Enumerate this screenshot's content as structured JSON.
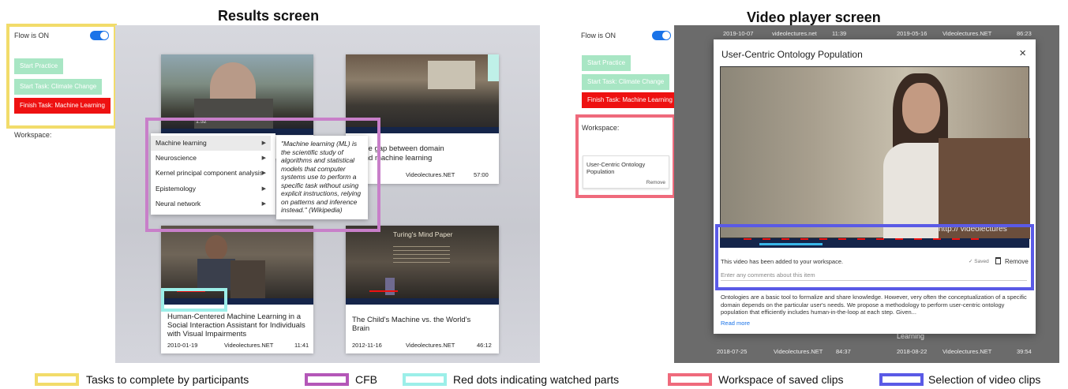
{
  "results": {
    "title": "Results screen",
    "flow_label": "Flow is ON",
    "buttons": {
      "practice": "Start Practice",
      "task_climate": "Start Task: Climate Change",
      "task_ml": "Finish Task: Machine Learning"
    },
    "workspace_label": "Workspace:",
    "thumb_time": "1:52",
    "cards": [
      {
        "title": "",
        "date": "",
        "source": "",
        "duration": ""
      },
      {
        "title_line1": "ging the gap between domain",
        "title_line2": "erts and machine learning",
        "date": "11-07",
        "source": "Videolectures.NET",
        "duration": "57:00"
      },
      {
        "title_line1": "Human-Centered Machine Learning in a",
        "title_line2": "Social Interaction Assistant for Individuals",
        "title_line3": "with Visual Impairments",
        "date": "2010-01-19",
        "source": "Videolectures.NET",
        "duration": "11:41"
      },
      {
        "title_line1": "The Child's Machine vs. the World's",
        "title_line2": "Brain",
        "date": "2012-11-16",
        "source": "Videolectures.NET",
        "duration": "46:12",
        "slide_title": "Turing's Mind Paper"
      }
    ],
    "menu_items": [
      "Machine learning",
      "Neuroscience",
      "Kernel principal component analysis",
      "Epistemology",
      "Neural network"
    ],
    "definition": "\"Machine learning (ML) is the scientific study of algorithms and statistical models that computer systems use to perform a specific task without using explicit instructions, relying on patterns and inference instead.\" (Wikipedia)"
  },
  "player": {
    "title": "Video player screen",
    "flow_label": "Flow is ON",
    "buttons": {
      "practice": "Start Practice",
      "task_climate": "Start Task: Climate Change",
      "task_ml": "Finish Task: Machine Learning"
    },
    "workspace_label": "Workspace:",
    "workspace_item": "User-Centric Ontology Population",
    "workspace_remove": "Remove",
    "bg_top": [
      {
        "date": "2019-10-07",
        "source": "videolectures.net",
        "duration": "11:39"
      },
      {
        "date": "2019-05-16",
        "source": "Videolectures.NET",
        "duration": "86:23"
      }
    ],
    "bg_bottom": [
      {
        "date": "2018-07-25",
        "source": "Videolectures.NET",
        "duration": "84:37"
      },
      {
        "date": "2018-08-22",
        "source": "Videolectures.NET",
        "duration": "39:54",
        "title": "Learning"
      }
    ],
    "modal": {
      "title": "User-Centric Ontology Population",
      "close": "×",
      "watermark": "http:// videolectures",
      "added": "This video has been added to your workspace.",
      "saved": "✓ Saved",
      "remove": "Remove",
      "comment_placeholder": "Enter any comments about this item",
      "description": "Ontologies are a basic tool to formalize and share knowledge. However, very often the conceptualization of a specific domain depends on the particular user's needs. We propose a methodology to perform user-centric ontology population that efficiently includes human-in-the-loop at each step. Given...",
      "read_more": "Read more"
    }
  },
  "legend": [
    {
      "label": "Tasks to complete by participants",
      "color": "#f2dc6a"
    },
    {
      "label": "CFB",
      "color": "#b457b8"
    },
    {
      "label": "Red dots indicating watched parts",
      "color": "#9cefe9"
    },
    {
      "label": "Workspace of saved clips",
      "color": "#ef6a7c"
    },
    {
      "label": "Selection of video clips",
      "color": "#5a5ae6"
    }
  ],
  "colors": {
    "accent": "#1a73e8",
    "red_button": "#ee1111",
    "green_button": "#a8e6c4",
    "timeline": "#15254a"
  }
}
